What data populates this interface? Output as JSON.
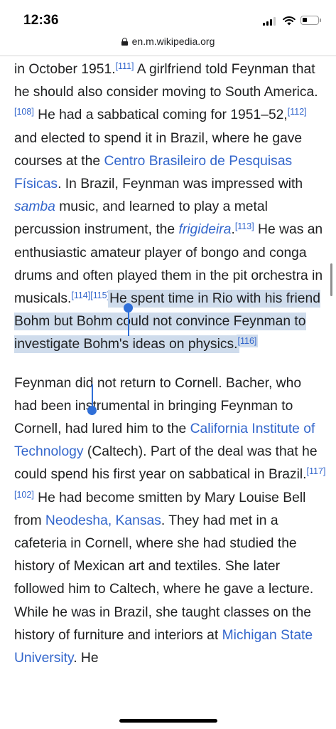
{
  "status_bar": {
    "time": "12:36"
  },
  "browser": {
    "url": "en.m.wikipedia.org"
  },
  "article": {
    "p1": {
      "t1": "in October 1951.",
      "r111": "[111]",
      "t2": " A girlfriend told Feynman that he should also consider moving to South America.",
      "r108": "[108]",
      "t3": " He had a sabbatical coming for 1951–52,",
      "r112": "[112]",
      "t4": " and elected to spend it in Brazil, where he gave courses at the ",
      "link_cbpf": "Centro Brasileiro de Pesquisas Físicas",
      "t5": ". In Brazil, Feynman was impressed with ",
      "link_samba": "samba",
      "t6": " music, and learned to play a metal percussion instrument, the ",
      "link_frigideira": "frigideira",
      "t7": ".",
      "r113": "[113]",
      "t8": " He was an enthusiastic amateur player of bongo and conga drums and often played them in the pit orchestra in musicals.",
      "r114": "[114]",
      "r115": "[115]",
      "sel_text": "He spent time in Rio with his friend Bohm but Bohm could not convince Feynman to investigate Bohm's ideas on physics.",
      "r116": "[116]"
    },
    "p2": {
      "t1": "Feynman did not return to Cornell. Bacher, who had been instrumental in bringing Feynman to Cornell, had lured him to the ",
      "link_caltech": "California Institute of Technology",
      "t2": " (Caltech). Part of the deal was that he could spend his first year on sabbatical in Brazil.",
      "r117": "[117]",
      "r102": "[102]",
      "t3": " He had become smitten by Mary Louise Bell from ",
      "link_neodesha": "Neodesha, Kansas",
      "t4": ". They had met in a cafeteria in Cornell, where she had studied the history of Mexican art and textiles. She later followed him to Caltech, where he gave a lecture. While he was in Brazil, she taught classes on the history of furniture and interiors at ",
      "link_msu": "Michigan State University",
      "t5": ". He"
    }
  }
}
